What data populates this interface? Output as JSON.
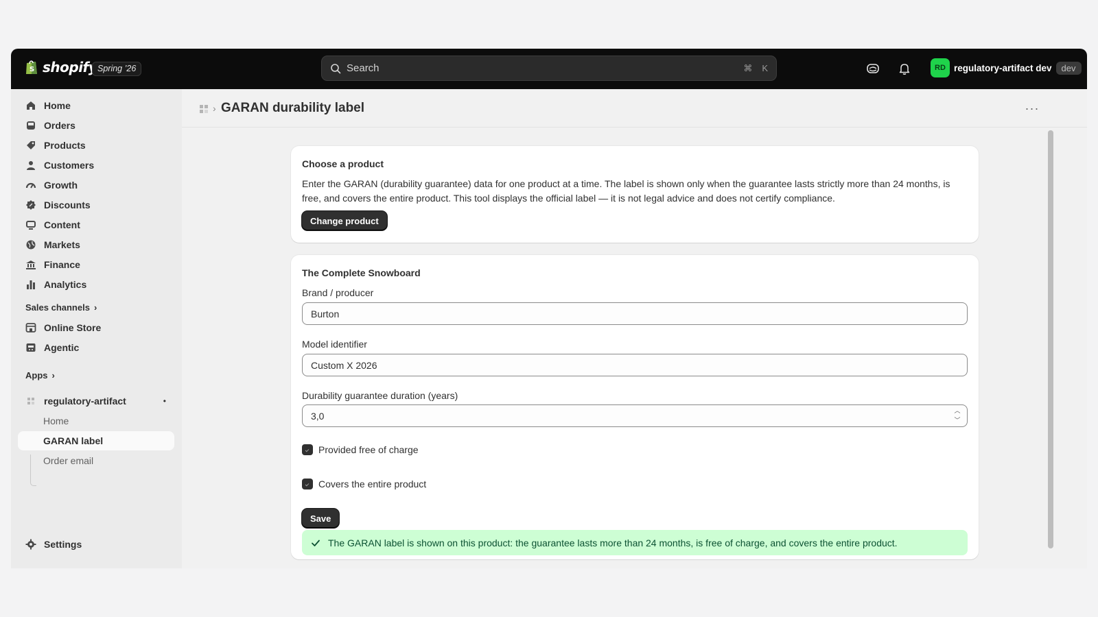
{
  "topbar": {
    "logo_text": "shopify",
    "edition": "Spring ’26",
    "search_placeholder": "Search",
    "search_shortcut_cmd": "⌘",
    "search_shortcut_key": "K",
    "avatar_initials": "RD",
    "store_name": "regulatory-artifact dev",
    "dev_badge": "dev",
    "icons": [
      "sidekick-icon",
      "bell-icon"
    ]
  },
  "sidebar": {
    "items": [
      {
        "label": "Home",
        "icon": "home-icon"
      },
      {
        "label": "Orders",
        "icon": "inbox-icon"
      },
      {
        "label": "Products",
        "icon": "tag-icon"
      },
      {
        "label": "Customers",
        "icon": "person-icon"
      },
      {
        "label": "Growth",
        "icon": "gauge-icon"
      },
      {
        "label": "Discounts",
        "icon": "discount-icon"
      },
      {
        "label": "Content",
        "icon": "content-icon"
      },
      {
        "label": "Markets",
        "icon": "globe-icon"
      },
      {
        "label": "Finance",
        "icon": "bank-icon"
      },
      {
        "label": "Analytics",
        "icon": "chart-bar-icon"
      }
    ],
    "sales_channels_label": "Sales channels",
    "channels": [
      {
        "label": "Online Store",
        "icon": "store-icon"
      },
      {
        "label": "Agentic",
        "icon": "agentic-icon"
      }
    ],
    "apps_label": "Apps",
    "app": {
      "name": "regulatory-artifact",
      "sub_items": [
        {
          "label": "Home",
          "active": false
        },
        {
          "label": "GARAN label",
          "active": true
        },
        {
          "label": "Order email",
          "active": false
        }
      ]
    },
    "settings_label": "Settings"
  },
  "page": {
    "title": "GARAN durability label",
    "more_label": "···"
  },
  "choose_card": {
    "title": "Choose a product",
    "description": "Enter the GARAN (durability guarantee) data for one product at a time. The label is shown only when the guarantee lasts strictly more than 24 months, is free, and covers the entire product. This tool displays the official label — it is not legal advice and does not certify compliance.",
    "button_label": "Change product"
  },
  "form_card": {
    "title": "The Complete Snowboard",
    "brand_label": "Brand / producer",
    "brand_value": "Burton",
    "model_label": "Model identifier",
    "model_value": "Custom X 2026",
    "duration_label": "Durability guarantee duration (years)",
    "duration_value": "3,0",
    "free_label": "Provided free of charge",
    "free_checked": true,
    "entire_label": "Covers the entire product",
    "entire_checked": true,
    "save_label": "Save",
    "banner_text": "The GARAN label is shown on this product: the guarantee lasts more than 24 months, is free of charge, and covers the entire product."
  },
  "colors": {
    "topbar": "#0c0c0c",
    "accent_green": "#1fd34b",
    "success_banner": "#cdfed4",
    "primary_button": "#303030"
  }
}
